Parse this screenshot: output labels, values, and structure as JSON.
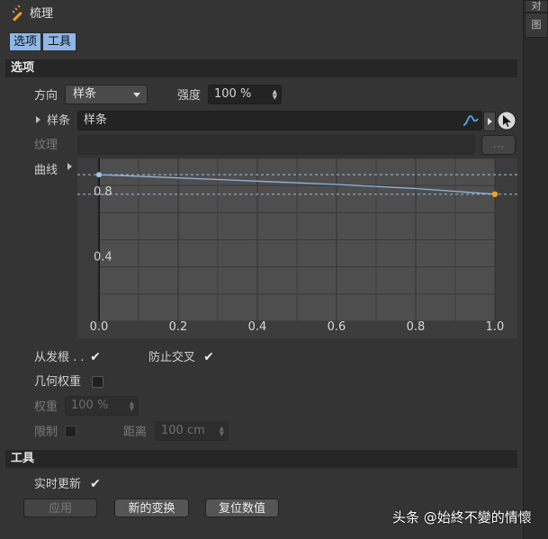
{
  "header": {
    "title": "梳理",
    "tabs": [
      {
        "label": "选项",
        "active": true
      },
      {
        "label": "工具",
        "active": true
      }
    ]
  },
  "right_strip": {
    "tabs": [
      "对",
      "图"
    ]
  },
  "sections": {
    "options": "选项",
    "tools": "工具"
  },
  "options": {
    "direction": {
      "label": "方向",
      "value": "样条"
    },
    "strength": {
      "label": "强度",
      "value": "100 %"
    },
    "spline": {
      "label": "样条",
      "value": "样条"
    },
    "texture": {
      "label": "纹理",
      "value": "",
      "button": "..."
    },
    "curve": {
      "label": "曲线"
    },
    "from_root": {
      "label": "从发根 . .",
      "checked": true
    },
    "prevent_cross": {
      "label": "防止交叉",
      "checked": true
    },
    "geometry_weight": {
      "label": "几何权重",
      "checked": false
    },
    "weight": {
      "label": "权重",
      "value": "100 %"
    },
    "limit": {
      "label": "限制",
      "checked": false
    },
    "distance": {
      "label": "距离",
      "value": "100 cm"
    }
  },
  "tools": {
    "realtime_update": {
      "label": "实时更新",
      "checked": true
    },
    "buttons": {
      "apply": "应用",
      "new_transform": "新的变换",
      "reset_values": "复位数值"
    }
  },
  "watermark": "头条 @始終不變的情懷",
  "chart_data": {
    "type": "line",
    "x_ticks": [
      "0.0",
      "0.2",
      "0.4",
      "0.6",
      "0.8",
      "1.0"
    ],
    "y_ticks": [
      "0.8",
      "0.4"
    ],
    "x": [
      0.0,
      0.2,
      0.4,
      0.6,
      0.8,
      1.0
    ],
    "y": [
      0.9,
      0.88,
      0.86,
      0.84,
      0.815,
      0.78
    ],
    "xlim": [
      0.0,
      1.0
    ],
    "ylim": [
      0.0,
      1.0
    ],
    "grid": true,
    "colors": {
      "curve": "#8fb4e0",
      "start_point": "#9ec3ee",
      "end_point": "#f0a020"
    }
  }
}
